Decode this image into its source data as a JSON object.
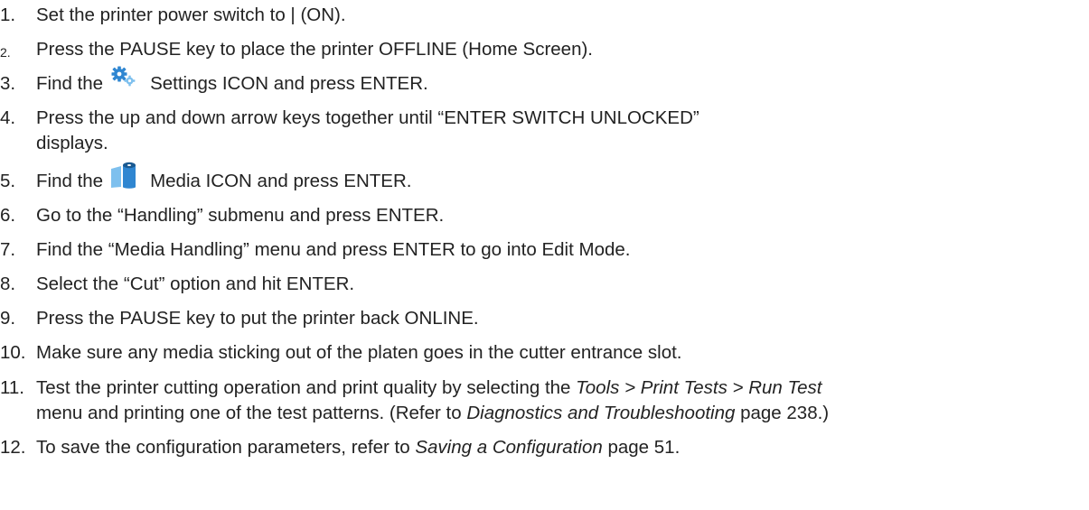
{
  "steps": [
    {
      "num": "1.",
      "text": "Set the printer power switch to | (ON)."
    },
    {
      "num": "2.",
      "text": "Press the PAUSE key to place the printer OFFLINE (Home Screen)."
    },
    {
      "num": "3.",
      "pre": "Find the",
      "icon": "settings-gear-icon",
      "post": "Settings ICON and press ENTER."
    },
    {
      "num": "4.",
      "text": "Press the up and down arrow keys together until “ENTER SWITCH UNLOCKED”",
      "text2": "displays."
    },
    {
      "num": "5.",
      "pre": "Find the",
      "icon": "media-roll-icon",
      "post": "Media ICON and press ENTER."
    },
    {
      "num": "6.",
      "text": "Go to the “Handling” submenu and press ENTER."
    },
    {
      "num": "7.",
      "text": "Find the “Media Handling” menu and press ENTER to go into Edit Mode."
    },
    {
      "num": "8.",
      "text": "Select the “Cut” option and hit ENTER."
    },
    {
      "num": "9.",
      "text": "Press the PAUSE key to put the printer back ONLINE."
    },
    {
      "num": "10.",
      "text": "Make sure any media sticking out of the platen goes in the cutter entrance  slot."
    },
    {
      "num": "11.",
      "t1": "Test the printer cutting operation and print quality by selecting the ",
      "t1_italic": "Tools > Print Tests > Run Test",
      "t2": "menu and printing one of the test patterns.  (Refer to ",
      "t2_italic": "Diagnostics and Troubleshooting",
      "t2_end": " page 238.)"
    },
    {
      "num": "12.",
      "t1": "To save the configuration parameters, refer to ",
      "t1_italic": "Saving a Configuration",
      "t1_end": " page 51."
    }
  ],
  "colors": {
    "text": "#222222",
    "icon_blue": "#2f86d1",
    "icon_light_blue": "#7ec0ee",
    "icon_dark": "#1a5a92"
  }
}
